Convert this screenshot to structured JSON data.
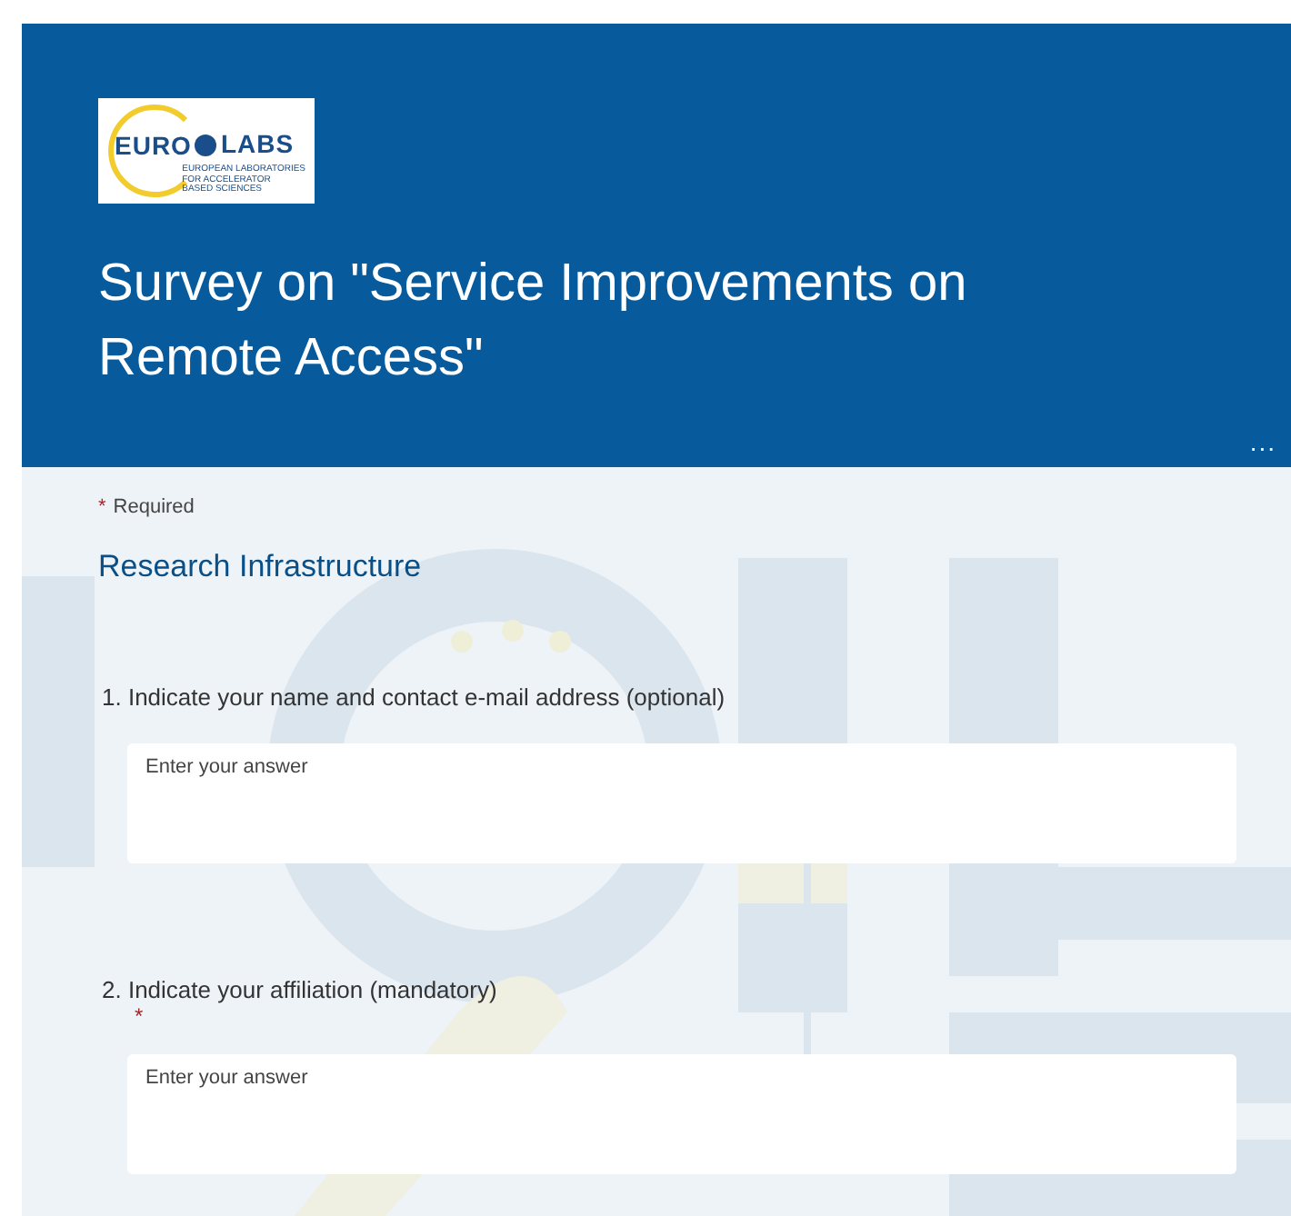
{
  "header": {
    "logo": {
      "left": "EURO",
      "right": "LABS",
      "tagline": [
        "EUROPEAN LABORATORIES",
        "FOR ACCELERATOR",
        "BASED SCIENCES"
      ]
    },
    "title": "Survey on \"Service Improvements on Remote Access\"",
    "more": "..."
  },
  "required_note": {
    "mark": "*",
    "text": "Required"
  },
  "section": "Research Infrastructure",
  "questions": [
    {
      "number": "1.",
      "text": "Indicate your name and contact e-mail address (optional)",
      "required": false,
      "placeholder": "Enter your answer"
    },
    {
      "number": "2.",
      "text": "Indicate your affiliation (mandatory)",
      "required": true,
      "placeholder": "Enter your answer"
    }
  ]
}
